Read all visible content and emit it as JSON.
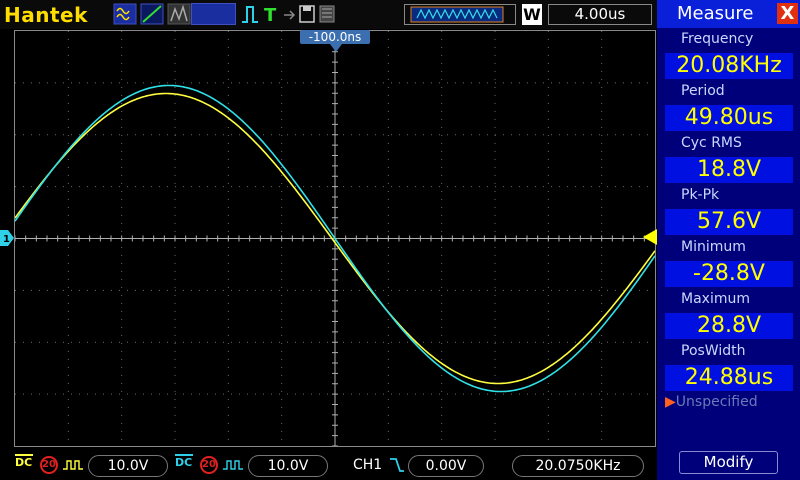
{
  "toolbar": {
    "brand": "Hantek",
    "timebase": "4.00us",
    "mode_letter": "W",
    "trigger_offset": "-100.0ns"
  },
  "measure_panel": {
    "title": "Measure",
    "close": "X",
    "items": [
      {
        "label": "Frequency",
        "value": "20.08KHz"
      },
      {
        "label": "Period",
        "value": "49.80us"
      },
      {
        "label": "Cyc RMS",
        "value": "18.8V"
      },
      {
        "label": "Pk-Pk",
        "value": "57.6V"
      },
      {
        "label": "Minimum",
        "value": "-28.8V"
      },
      {
        "label": "Maximum",
        "value": "28.8V"
      },
      {
        "label": "PosWidth",
        "value": "24.88us"
      }
    ],
    "unspecified": "Unspecified",
    "modify": "Modify"
  },
  "bottom": {
    "ch1": {
      "coupling": "DC",
      "bw_limit": "20",
      "scale": "10.0V"
    },
    "ch2": {
      "coupling": "DC",
      "bw_limit": "20",
      "scale": "10.0V"
    },
    "trigger": {
      "source": "CH1",
      "level": "0.00V"
    },
    "freq_counter": "20.0750KHz"
  },
  "markers": {
    "ch1_ground": "1"
  },
  "colors": {
    "ch1": "#ffff40",
    "ch2": "#30e0e8",
    "panel": "#00007a",
    "accent": "#0a1fd8",
    "brand": "#ffdd00"
  }
}
